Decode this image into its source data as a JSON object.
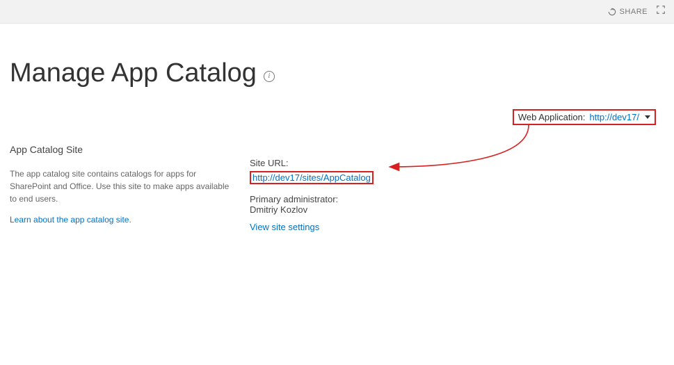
{
  "topbar": {
    "share_label": "SHARE"
  },
  "page": {
    "title": "Manage App Catalog"
  },
  "webapp": {
    "label": "Web Application:",
    "value": "http://dev17/"
  },
  "left": {
    "heading": "App Catalog Site",
    "description": "The app catalog site contains catalogs for apps for SharePoint and Office. Use this site to make apps available to end users.",
    "learn_link": "Learn about the app catalog site."
  },
  "right": {
    "site_url_label": "Site URL:",
    "site_url_value": "http://dev17/sites/AppCatalog",
    "admin_label": "Primary administrator:",
    "admin_value": "Dmitriy Kozlov",
    "view_settings": "View site settings"
  }
}
